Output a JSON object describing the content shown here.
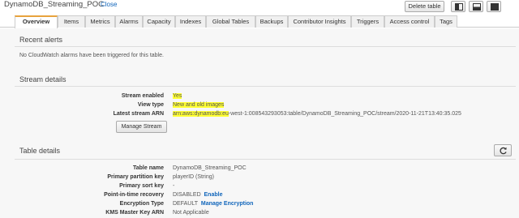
{
  "header": {
    "table_name": "DynamoDB_Streaming_POC",
    "close_label": "Close",
    "delete_label": "Delete table"
  },
  "tabs": [
    {
      "label": "Overview",
      "active": true
    },
    {
      "label": "Items"
    },
    {
      "label": "Metrics"
    },
    {
      "label": "Alarms"
    },
    {
      "label": "Capacity"
    },
    {
      "label": "Indexes"
    },
    {
      "label": "Global Tables"
    },
    {
      "label": "Backups"
    },
    {
      "label": "Contributor Insights"
    },
    {
      "label": "Triggers"
    },
    {
      "label": "Access control"
    },
    {
      "label": "Tags"
    }
  ],
  "recent_alerts": {
    "title": "Recent alerts",
    "message": "No CloudWatch alarms have been triggered for this table."
  },
  "stream_details": {
    "title": "Stream details",
    "rows": [
      {
        "label": "Stream enabled",
        "value": "Yes"
      },
      {
        "label": "View type",
        "value": "New and old images"
      },
      {
        "label": "Latest stream ARN",
        "value_highlight": "arn:aws:dynamodb:eu",
        "value_rest": "-west-1:008543293053:table/DynamoDB_Streaming_POC/stream/2020-11-21T13:40:35.025"
      }
    ],
    "manage_button": "Manage Stream"
  },
  "table_details": {
    "title": "Table details",
    "rows": [
      {
        "label": "Table name",
        "value": "DynamoDB_Streaming_POC"
      },
      {
        "label": "Primary partition key",
        "value": "playerID (String)"
      },
      {
        "label": "Primary sort key",
        "value": "-"
      },
      {
        "label": "Point-in-time recovery",
        "value": "DISABLED",
        "link": "Enable"
      },
      {
        "label": "Encryption Type",
        "value": "DEFAULT",
        "link": "Manage Encryption"
      },
      {
        "label": "KMS Master Key ARN",
        "value": "Not Applicable"
      }
    ]
  },
  "colors": {
    "highlight": "#ffff33",
    "active_tab_accent": "#e8a33d",
    "link": "#1166bb"
  }
}
